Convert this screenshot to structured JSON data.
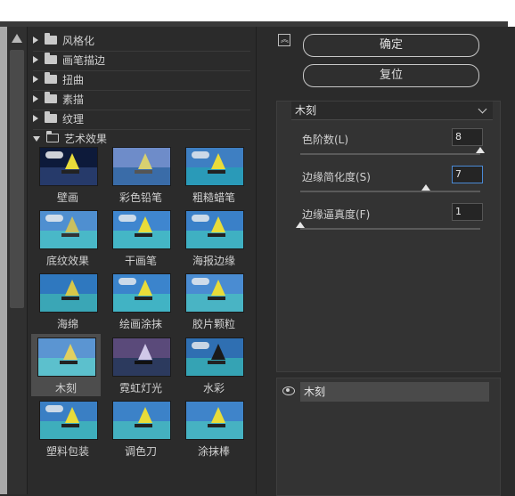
{
  "categories": [
    {
      "label": "风格化",
      "expanded": false
    },
    {
      "label": "画笔描边",
      "expanded": false
    },
    {
      "label": "扭曲",
      "expanded": false
    },
    {
      "label": "素描",
      "expanded": false
    },
    {
      "label": "纹理",
      "expanded": false
    },
    {
      "label": "艺术效果",
      "expanded": true
    }
  ],
  "filters": [
    {
      "label": "壁画"
    },
    {
      "label": "彩色铅笔"
    },
    {
      "label": "粗糙蜡笔"
    },
    {
      "label": "底纹效果"
    },
    {
      "label": "干画笔"
    },
    {
      "label": "海报边缘"
    },
    {
      "label": "海绵"
    },
    {
      "label": "绘画涂抹"
    },
    {
      "label": "胶片颗粒"
    },
    {
      "label": "木刻",
      "selected": true
    },
    {
      "label": "霓虹灯光"
    },
    {
      "label": "水彩"
    },
    {
      "label": "塑料包装"
    },
    {
      "label": "调色刀"
    },
    {
      "label": "涂抹棒"
    }
  ],
  "buttons": {
    "ok": "确定",
    "reset": "复位"
  },
  "settings": {
    "filter_select": "木刻",
    "params": [
      {
        "label": "色阶数(L)",
        "value": "8",
        "level": 1.0
      },
      {
        "label": "边缘简化度(S)",
        "value": "7",
        "level": 0.7
      },
      {
        "label": "边缘逼真度(F)",
        "value": "1",
        "level": 0.0
      }
    ]
  },
  "layer": {
    "name": "木刻"
  },
  "colors": {
    "panel": "#2b2b2b",
    "accent": "#4a8ad6"
  },
  "icons": {
    "collapse": "collapse-icon",
    "eye": "eye-icon",
    "folder": "folder-icon"
  }
}
